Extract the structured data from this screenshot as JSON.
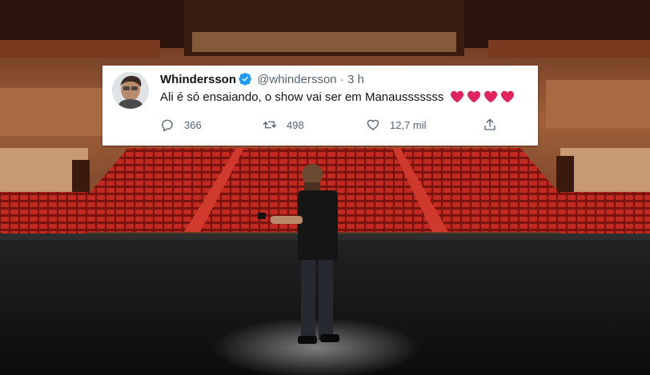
{
  "tweet": {
    "display_name": "Whindersson",
    "handle": "@whindersson",
    "separator": "·",
    "time": "3 h",
    "text": "Ali é só ensaiando, o show vai ser em Manausssssss",
    "heart_emoji_count": 4,
    "stats": {
      "replies": "366",
      "retweets": "498",
      "likes": "12,7 mil"
    },
    "icons": [
      "reply-icon",
      "retweet-icon",
      "like-icon",
      "share-icon"
    ],
    "verified_color": "#1d9bf0",
    "heart_color": "#e0245e"
  },
  "background": {
    "description_colors": {
      "seats": "#b3241c",
      "stage": "#121212",
      "walls": "#8a4a2a"
    }
  }
}
